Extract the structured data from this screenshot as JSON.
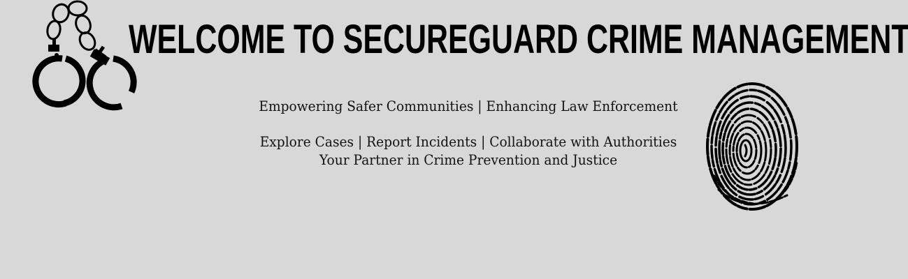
{
  "banner": {
    "title": "WELCOME TO SECUREGUARD CRIME MANAGEMENT",
    "tagline_1": "Empowering Safer Communities | Enhancing Law Enforcement",
    "tagline_2": "Explore Cases | Report Incidents | Collaborate with Authorities",
    "tagline_3": "Your Partner in Crime Prevention and Justice"
  },
  "icons": {
    "left": "handcuffs-icon",
    "right": "fingerprint-icon"
  },
  "colors": {
    "background": "#d8d8d8",
    "text": "#000000"
  }
}
